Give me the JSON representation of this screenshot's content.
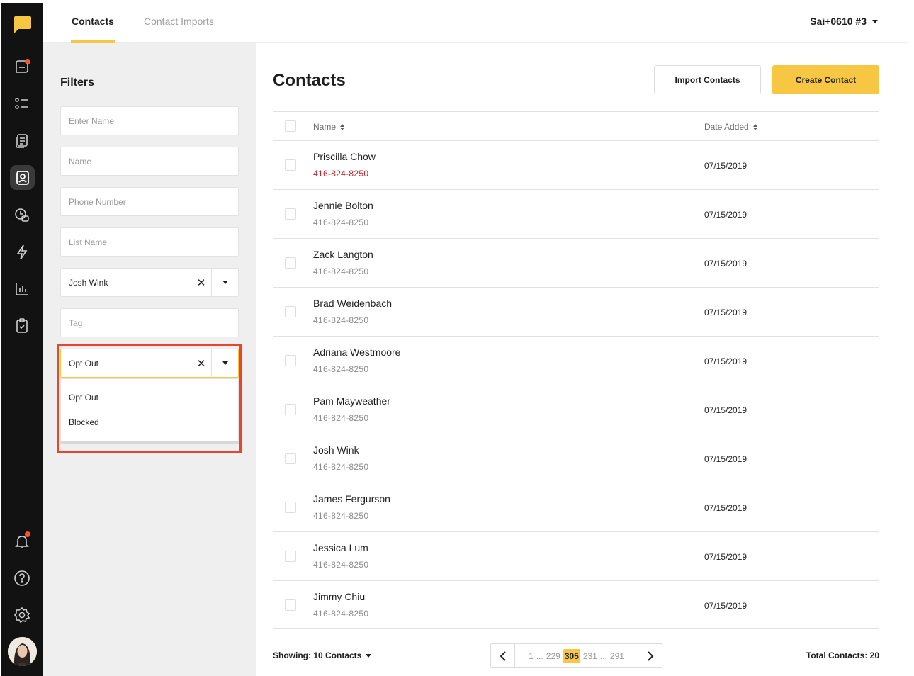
{
  "nav": {
    "tabs": [
      {
        "label": "Contacts",
        "active": true
      },
      {
        "label": "Contact Imports",
        "active": false
      }
    ],
    "account": "Sai+0610 #3"
  },
  "rail": {
    "icons": [
      "logo-icon",
      "inbox-icon",
      "list-icon",
      "templates-icon",
      "contacts-icon",
      "scheduled-icon",
      "automation-icon",
      "analytics-icon",
      "tasks-icon",
      "bell-icon",
      "help-icon",
      "settings-icon"
    ],
    "notification_color": "#ff5230"
  },
  "filters": {
    "title": "Filters",
    "enter_name_placeholder": "Enter Name",
    "name_placeholder": "Name",
    "phone_placeholder": "Phone Number",
    "list_name_placeholder": "List Name",
    "assignee_value": "Josh Wink",
    "tag_placeholder": "Tag",
    "status_value": "Opt Out",
    "status_options": [
      "Opt Out",
      "Blocked"
    ]
  },
  "main": {
    "title": "Contacts",
    "import_button": "Import Contacts",
    "create_button": "Create Contact",
    "columns": {
      "name": "Name",
      "date": "Date Added"
    },
    "rows": [
      {
        "name": "Priscilla Chow",
        "phone": "416-824-8250",
        "date": "07/15/2019",
        "phone_red": true
      },
      {
        "name": "Jennie Bolton",
        "phone": "416-824-8250",
        "date": "07/15/2019"
      },
      {
        "name": "Zack Langton",
        "phone": "416-824-8250",
        "date": "07/15/2019"
      },
      {
        "name": "Brad Weidenbach",
        "phone": "416-824-8250",
        "date": "07/15/2019"
      },
      {
        "name": "Adriana Westmoore",
        "phone": "416-824-8250",
        "date": "07/15/2019"
      },
      {
        "name": "Pam Mayweather",
        "phone": "416-824-8250",
        "date": "07/15/2019"
      },
      {
        "name": "Josh Wink",
        "phone": "416-824-8250",
        "date": "07/15/2019"
      },
      {
        "name": "James Fergurson",
        "phone": "416-824-8250",
        "date": "07/15/2019"
      },
      {
        "name": "Jessica Lum",
        "phone": "416-824-8250",
        "date": "07/15/2019"
      },
      {
        "name": "Jimmy Chiu",
        "phone": "416-824-8250",
        "date": "07/15/2019"
      }
    ]
  },
  "footer": {
    "showing": "Showing: 10 Contacts",
    "pages": {
      "first": "1",
      "ellipsis_a": "...",
      "p_prev": "229",
      "current": "305",
      "p_next": "231",
      "ellipsis_b": "...",
      "last": "291"
    },
    "total": "Total Contacts: 20"
  },
  "colors": {
    "accent": "#f7c744",
    "highlight_box": "#e8452c",
    "phone_alert": "#c8202c"
  }
}
